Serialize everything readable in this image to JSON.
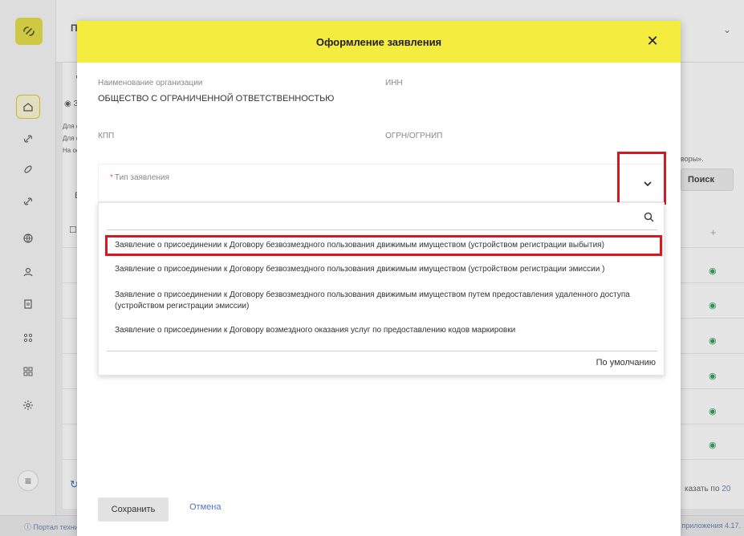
{
  "background": {
    "top_bar_text": "ПР",
    "fragment_d": "Д",
    "fragment_radio": "◉ З",
    "fragment_lines": [
      "Для с",
      "Для с",
      "На ос"
    ],
    "fragment_b": "В",
    "fragment_right": "воры».",
    "search_button": "Поиск",
    "pager_label": "казать по",
    "pager_value": "20",
    "footer_left": "Портал техни",
    "footer_right": "приложения 4.17."
  },
  "modal": {
    "title": "Оформление заявления",
    "org_name_label": "Наименование организации",
    "org_name_value": "ОБЩЕСТВО С ОГРАНИЧЕННОЙ ОТВЕТСТВЕННОСТЬЮ",
    "inn_label": "ИНН",
    "kpp_label": "КПП",
    "ogrn_label": "ОГРН/ОГРНИП",
    "type_label": "Тип заявления",
    "type_required_mark": "*",
    "search": {
      "value": "",
      "placeholder": ""
    },
    "options": [
      "Заявление о присоединении к Договору безвозмездного пользования движимым имуществом (устройством регистрации выбытия)",
      "Заявление о присоединении к Договору безвозмездного пользования движимым имуществом (устройством регистрации эмиссии )",
      "Заявление о присоединении к Договору безвозмездного пользования движимым имуществом путем предоставления удаленного доступа (устройством регистрации эмиссии)",
      "Заявление о присоединении к Договору возмездного оказания услуг по предоставлению кодов маркировки"
    ],
    "selected_option_index": 0,
    "default_label": "По умолчанию",
    "save_label": "Сохранить",
    "cancel_label": "Отмена"
  },
  "colors": {
    "header_yellow": "#f4ec3e",
    "highlight_red": "#d8181e",
    "link_blue": "#4b77c4",
    "eye_green": "#35a35e"
  },
  "icons": [
    "logo-icon",
    "home-icon",
    "link-icon",
    "globe-icon",
    "user-icon",
    "document-icon",
    "grid-icon",
    "settings-icon",
    "menu-icon",
    "close-icon",
    "chevron-down-icon",
    "search-icon",
    "eye-icon",
    "plus-icon",
    "refresh-icon",
    "help-icon"
  ]
}
